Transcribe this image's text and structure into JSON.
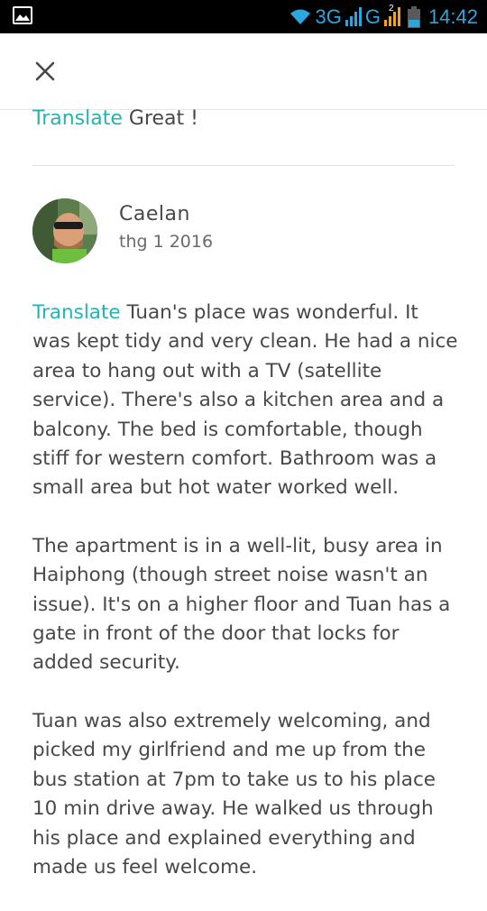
{
  "status_bar": {
    "network_3g": "3G",
    "network_g": "G",
    "sim2_badge": "2",
    "time": "14:42",
    "icons": [
      "gallery-icon",
      "wifi-icon",
      "signal-icon",
      "battery-icon"
    ],
    "accent_color": "#29a8e0"
  },
  "top_bar": {
    "close_icon": "close-icon"
  },
  "previous_review": {
    "translate_label": "Translate",
    "text": " Great !"
  },
  "review": {
    "reviewer_name": "Caelan",
    "date": "thg 1 2016",
    "translate_label": "Translate",
    "paragraphs": [
      " Tuan's place was wonderful. It was kept tidy and very clean. He had a nice area to hang out with a TV (satellite service). There's also a kitchen area and a balcony. The bed is comfortable, though stiff for western comfort. Bathroom was a small area but hot water worked well.",
      "The apartment is in a well-lit, busy area in Haiphong (though street noise wasn't an issue). It's on a higher floor and Tuan has a gate in front of the door that locks for added security.",
      "Tuan was also extremely welcoming, and picked my girlfriend and me up from the bus station at 7pm to take us to his place 10 min drive away. He walked us through his place and explained everything and made us feel welcome."
    ]
  },
  "colors": {
    "translate_link": "#23b3b3",
    "text": "#484848",
    "divider": "#e2e2e2"
  }
}
